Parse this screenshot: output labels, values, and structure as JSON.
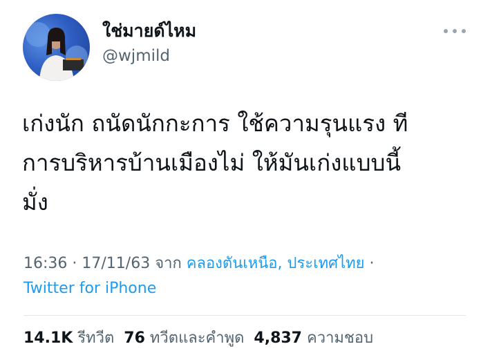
{
  "author": {
    "display_name": "ใช่มายด์ไหม",
    "handle": "@wjmild"
  },
  "tweet": {
    "lines": [
      "เก่งนัก ถนัดนักกะการ ใช้ความรุนแรง ที",
      "การบริหารบ้านเมืองไม่ ให้มันเก่งแบบนี้",
      "มั่ง"
    ]
  },
  "meta": {
    "time": "16:36",
    "dot1": " · ",
    "date": "17/11/63",
    "from": " จาก ",
    "location": "คลองตันเหนือ, ประเทศไทย",
    "dot2": " ·",
    "source": "Twitter for iPhone"
  },
  "stats": {
    "retweets": "14.1K",
    "retweets_label": "รีทวีต",
    "quotes": "76",
    "quotes_label": "ทวีตและคำพูด",
    "likes": "4,837",
    "likes_label": "ความชอบ"
  },
  "icons": {
    "more": "more-horizontal-icon"
  },
  "colors": {
    "link": "#1d9bf0",
    "secondary_text": "#536471",
    "primary_text": "#0f1419"
  }
}
